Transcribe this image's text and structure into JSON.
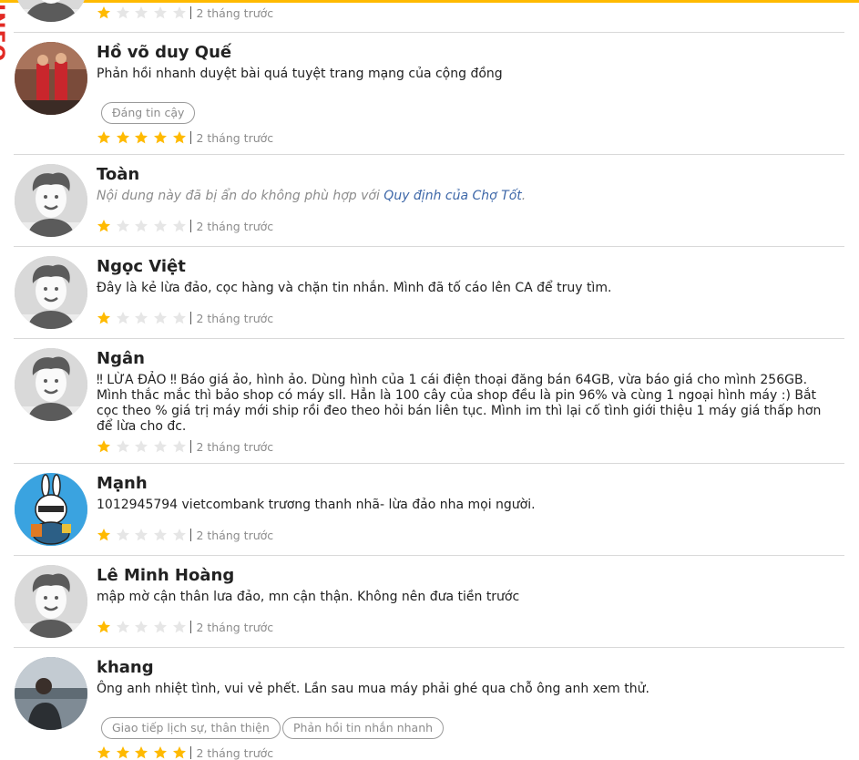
{
  "reviews": [
    {
      "name": "",
      "comment": "",
      "stars": 1,
      "time": "2 tháng trước",
      "tags": []
    },
    {
      "name": "Hồ võ duy Quế",
      "comment": "Phản hồi nhanh duyệt bài quá tuyệt trang mạng của cộng đồng",
      "stars": 5,
      "time": "2 tháng trước",
      "tags": [
        "Đáng tin cậy"
      ],
      "badge": "INFO"
    },
    {
      "name": "Toàn",
      "comment_prefix": "Nội dung này đã bị ẩn do không phù hợp với ",
      "comment_link": "Quy định của Chợ Tốt",
      "comment_suffix": ".",
      "stars": 1,
      "time": "2 tháng trước"
    },
    {
      "name": "Ngọc Việt",
      "comment": "Đây là kẻ lừa đảo, cọc hàng và chặn tin nhắn. Mình đã tố cáo lên CA để truy tìm.",
      "stars": 1,
      "time": "2 tháng trước"
    },
    {
      "name": "Ngân",
      "comment": "‼ LỪA ĐẢO ‼ Báo giá ảo, hình ảo. Dùng hình của 1 cái điện thoại đăng bán 64GB, vừa báo giá cho mình 256GB. Mình thắc mắc thì bảo shop có máy sll. Hẳn là 100 cây của shop đều là pin 96% và cùng 1 ngoại hình máy :) Bắt cọc theo % giá trị máy mới ship rồi đeo theo hỏi bán liên tục. Mình im thì lại cố tình giới thiệu 1 máy giá thấp hơn để lừa cho đc.",
      "stars": 1,
      "time": "2 tháng trước"
    },
    {
      "name": "Mạnh",
      "comment": "1012945794 vietcombank trương thanh nhã- lừa đảo nha mọi người.",
      "stars": 1,
      "time": "2 tháng trước"
    },
    {
      "name": "Lê Minh Hoàng",
      "comment": "mập mờ cận thân lưa đảo, mn cận thận. Không nên đưa tiền trước",
      "stars": 1,
      "time": "2 tháng trước"
    },
    {
      "name": "khang",
      "comment": "Ông anh nhiệt tình, vui vẻ phết. Lần sau mua máy phải ghé qua chỗ ông anh xem thử.",
      "stars": 5,
      "time": "2 tháng trước",
      "tags": [
        "Giao tiếp lịch sự, thân thiện",
        "Phản hồi tin nhắn nhanh"
      ]
    }
  ],
  "colors": {
    "accent": "#ffba00",
    "star_on": "#ffba00",
    "star_off": "#e6e6e6",
    "link": "#3d67a8",
    "badge": "#e22a24"
  },
  "icons": {
    "avatar_default": "default-user-avatar",
    "star": "star-icon"
  }
}
